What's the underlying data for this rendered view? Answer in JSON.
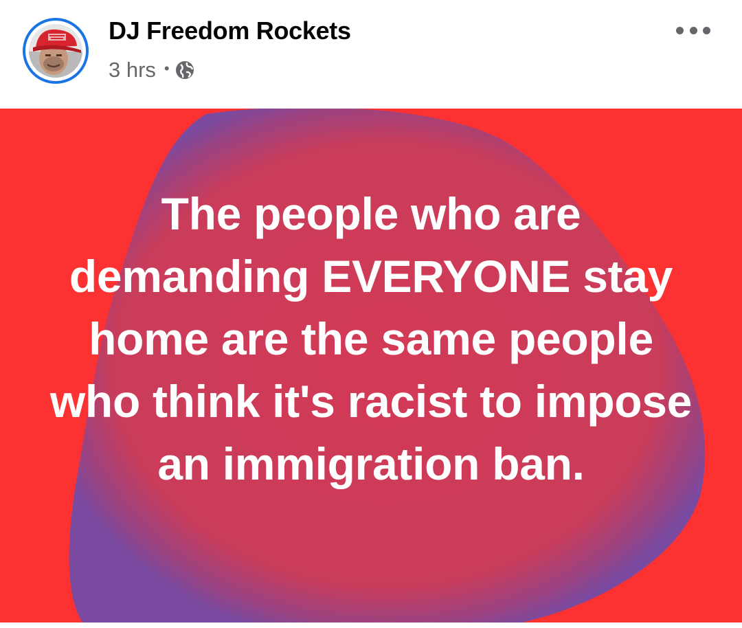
{
  "post": {
    "author": "DJ Freedom Rockets",
    "timestamp": "3 hrs",
    "separator": "•",
    "privacy_icon": "globe-icon",
    "more_icon": "more-options-icon",
    "text": "The people who are demanding EVERYONE stay home are the same people who think it's racist to impose an immigration ban."
  },
  "colors": {
    "background_red": "#fc3232",
    "blob_purple": "#7a4aa0",
    "blob_center": "#d33a55",
    "text": "#ffffff",
    "avatar_ring": "#1b74e4",
    "hat_red": "#d8242e"
  }
}
